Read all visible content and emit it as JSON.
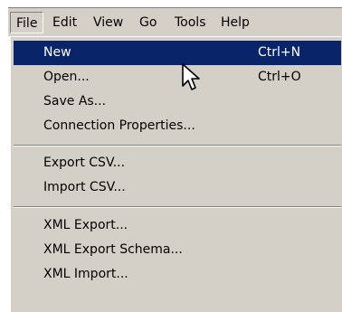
{
  "menubar": {
    "items": [
      "File",
      "Edit",
      "View",
      "Go",
      "Tools",
      "Help"
    ],
    "active": "File"
  },
  "file_menu": {
    "groups": [
      [
        {
          "label": "New",
          "shortcut": "Ctrl+N",
          "highlighted": true
        },
        {
          "label": "Open...",
          "shortcut": "Ctrl+O"
        },
        {
          "label": "Save As...",
          "shortcut": ""
        },
        {
          "label": "Connection Properties...",
          "shortcut": ""
        }
      ],
      [
        {
          "label": "Export CSV...",
          "shortcut": ""
        },
        {
          "label": "Import CSV...",
          "shortcut": ""
        }
      ],
      [
        {
          "label": "XML Export...",
          "shortcut": ""
        },
        {
          "label": "XML Export Schema...",
          "shortcut": ""
        },
        {
          "label": "XML Import...",
          "shortcut": ""
        }
      ]
    ]
  },
  "colors": {
    "menu_bg": "#d4d0c8",
    "highlight_bg": "#0a246a",
    "highlight_text": "#ffffff"
  },
  "icons": {
    "cursor": "mouse-pointer-icon"
  }
}
